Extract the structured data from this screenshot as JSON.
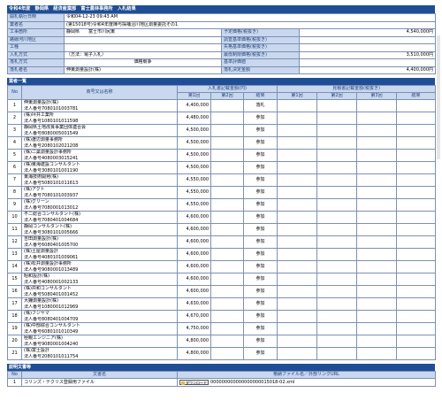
{
  "header": {
    "title": "令和4年度　静岡県　経済産業部　富士農林事務所　入札結果"
  },
  "info": {
    "opening_date_label": "開札執行日時",
    "opening_date_value": "令和04-12-23 09:43 AM",
    "business_name_label": "業者名",
    "business_name_value": "(第15018号)令和4年度陳与採補沼川地区測量委託その1",
    "location_label": "工事箇所",
    "location_value": "静岡県　　富士市川尻東",
    "area_label": "路線河川地区",
    "area_value": "",
    "type_label": "工種",
    "type_value": "",
    "method_label": "入札方式",
    "method_value": "（方法：電子入札）",
    "award_method_label": "落札方式",
    "award_method_value": "価格競争",
    "winner_label": "落札者名",
    "winner_value": "伸東測量設計(株)",
    "planned_price_label": "予定価格(税抜き)",
    "planned_price_value": "4,540,000円",
    "survey_base_label": "調査基準価格(税抜き)",
    "survey_base_value": "",
    "failure_base_label": "失格基準価格(税抜き)",
    "failure_base_value": "",
    "min_price_label": "最低制限価格(税抜き)",
    "min_price_value": "3,510,000円",
    "base_eval_label": "基準評価値",
    "base_eval_value": "",
    "award_amount_label": "落札決定金額",
    "award_amount_value": "4,400,000円"
  },
  "bidders": {
    "section_title": "業者一覧",
    "col_no": "No",
    "col_name": "商号又は名称",
    "col_bid_group": "入札書記載金額(円)",
    "col_estimate_group": "見積書記載金額(税抜き)",
    "col_round1": "第1回",
    "col_round2": "第2回",
    "col_result": "結果",
    "col_e1": "第1回",
    "col_e2": "第2回",
    "col_e3": "第3回",
    "col_eresult": "結果",
    "rows": [
      {
        "no": "1",
        "name": "伸東測量設計(株)",
        "reg": "法人番号7080101003781",
        "amount": "4,400,000",
        "result": "落札"
      },
      {
        "no": "2",
        "name": "(株)坪井工業所",
        "reg": "法人番号1080101011598",
        "amount": "4,480,000",
        "result": "参加"
      },
      {
        "no": "3",
        "name": "静岡県土地改良事業団体連合会",
        "reg": "法人番号8080005001549",
        "amount": "4,500,000",
        "result": "参加"
      },
      {
        "no": "4",
        "name": "(株)渡辺測量事務所",
        "reg": "法人番号2080102021208",
        "amount": "4,500,000",
        "result": "参加"
      },
      {
        "no": "5",
        "name": "(株)二葉測量設計事務所",
        "reg": "法人番号4080003015241",
        "amount": "4,500,000",
        "result": "参加"
      },
      {
        "no": "6",
        "name": "(株)東海建設コンサルタント",
        "reg": "法人番号3080101001190",
        "amount": "4,500,000",
        "result": "参加"
      },
      {
        "no": "7",
        "name": "東海技術開発(株)",
        "reg": "法人番号5080101011613",
        "amount": "4,550,000",
        "result": "参加"
      },
      {
        "no": "8",
        "name": "(株)アクト",
        "reg": "法人番号7080101003937",
        "amount": "4,550,000",
        "result": "参加"
      },
      {
        "no": "9",
        "name": "(株)グリーン",
        "reg": "法人番号7080001013012",
        "amount": "4,550,000",
        "result": "参加"
      },
      {
        "no": "10",
        "name": "不二総合コンサルタント(株)",
        "reg": "法人番号7080401004684",
        "amount": "4,600,000",
        "result": "参加"
      },
      {
        "no": "11",
        "name": "静岡コンサルタント(株)",
        "reg": "法人番号3080101005666",
        "amount": "4,600,000",
        "result": "参加"
      },
      {
        "no": "12",
        "name": "吉田測量設計(株)",
        "reg": "法人番号6080401005700",
        "amount": "4,600,000",
        "result": "参加"
      },
      {
        "no": "13",
        "name": "(株)土屋測量設計",
        "reg": "法人番号4080101009061",
        "amount": "4,600,000",
        "result": "参加"
      },
      {
        "no": "14",
        "name": "(株)松井測量設計事務所",
        "reg": "法人番号9080001013489",
        "amount": "4,600,000",
        "result": "参加"
      },
      {
        "no": "15",
        "name": "昭和設計(株)",
        "reg": "法人番号4080001002133",
        "amount": "4,600,000",
        "result": "参加"
      },
      {
        "no": "16",
        "name": "(株)共和コンサルタント",
        "reg": "法人番号5080401001452",
        "amount": "4,600,000",
        "result": "参加"
      },
      {
        "no": "17",
        "name": "大鐘測量設計(株)",
        "reg": "法人番号1080001012969",
        "amount": "4,630,000",
        "result": "参加"
      },
      {
        "no": "18",
        "name": "(株)フジヤマ",
        "reg": "法人番号8080401004709",
        "amount": "4,670,000",
        "result": "参加"
      },
      {
        "no": "19",
        "name": "(株)中部綜合コンサルタント",
        "reg": "法人番号6080101010349",
        "amount": "4,750,000",
        "result": "参加"
      },
      {
        "no": "20",
        "name": "極親エンジニア(株)",
        "reg": "法人番号9080001004240",
        "amount": "4,800,000",
        "result": "参加"
      },
      {
        "no": "21",
        "name": "(株)富士設計",
        "reg": "法人番号2080101011754",
        "amount": "4,800,000",
        "result": "参加"
      }
    ]
  },
  "docs": {
    "section_title": "説明文書等",
    "col_no": "No",
    "col_name": "文書名",
    "col_file": "格納ファイル名／外部リンクURL",
    "rows": [
      {
        "no": "1",
        "name": "コリンズ・テクリス登録用ファイル",
        "button": "ダウンロード",
        "file": "000000000000000000015018-02.xml"
      }
    ]
  }
}
